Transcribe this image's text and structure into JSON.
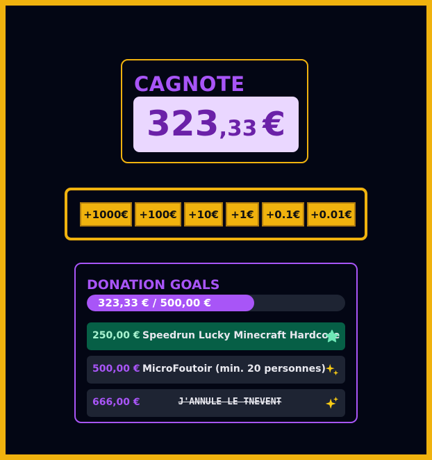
{
  "cagnote": {
    "title": "CAGNOTE",
    "amount_integer": "323",
    "amount_decimal": ",33",
    "currency": "€"
  },
  "buttons": [
    {
      "label": "+1000€"
    },
    {
      "label": "+100€"
    },
    {
      "label": "+10€"
    },
    {
      "label": "+1€"
    },
    {
      "label": "+0.1€"
    },
    {
      "label": "+0.01€"
    }
  ],
  "goals": {
    "title": "DONATION GOALS",
    "progress_label": "323,33 € / 500,00 €",
    "progress_fraction": 0.6467,
    "items": [
      {
        "amount": "250,00 €",
        "label": "Speedrun Lucky Minecraft Hardcore",
        "status": "reached",
        "icon": "star-icon"
      },
      {
        "amount": "500,00 €",
        "label": "MicroFoutoir (min. 20 personnes)",
        "status": "pending",
        "icon": "sparkles-icon"
      },
      {
        "amount": "666,00 €",
        "label": "J'ANNULE LE ŦNEVENŦ",
        "status": "pending",
        "icon": "sparkles-icon"
      }
    ]
  },
  "colors": {
    "accent_gold": "#f0b20e",
    "accent_purple": "#a855f7",
    "background": "#030614",
    "goal_reached": "#065f46"
  }
}
